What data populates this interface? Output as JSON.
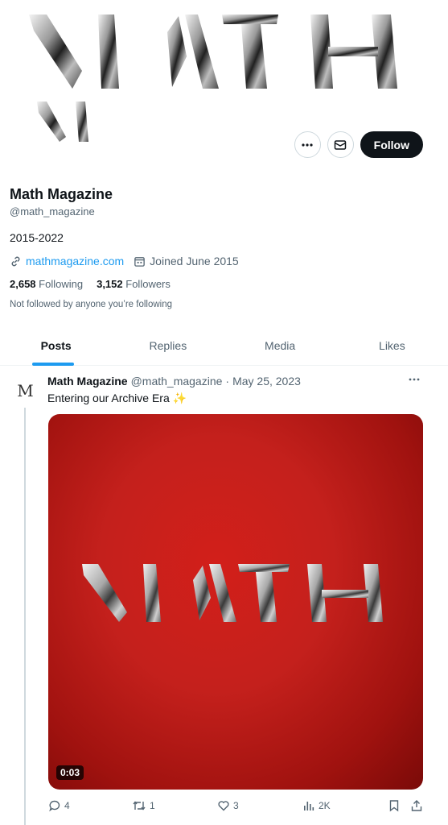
{
  "banner": {
    "wordmark_line1": "MATH",
    "wordmark_line2": "M"
  },
  "profile": {
    "more_icon": "more-dots-icon",
    "message_icon": "envelope-icon",
    "follow_label": "Follow",
    "name": "Math Magazine",
    "handle": "@math_magazine",
    "bio": "2015-2022",
    "website": "mathmagazine.com",
    "joined": "Joined June 2015",
    "following_count": "2,658",
    "following_label": "Following",
    "followers_count": "3,152",
    "followers_label": "Followers",
    "not_followed": "Not followed by anyone you’re following"
  },
  "tabs": [
    {
      "label": "Posts",
      "active": true
    },
    {
      "label": "Replies"
    },
    {
      "label": "Media"
    },
    {
      "label": "Likes"
    }
  ],
  "tweet": {
    "avatar_text": "M",
    "author": "Math Magazine",
    "handle": "@math_magazine",
    "separator": "·",
    "date": "May 25, 2023",
    "text": "Entering our Archive Era ✨",
    "media_wordmark": "MATH",
    "duration": "0:03",
    "replies": "4",
    "retweets": "1",
    "likes": "3",
    "views": "2K"
  },
  "colors": {
    "accent": "#1d9bf0",
    "text": "#0f1419",
    "secondary": "#536471",
    "media_red": "#c4201c"
  }
}
